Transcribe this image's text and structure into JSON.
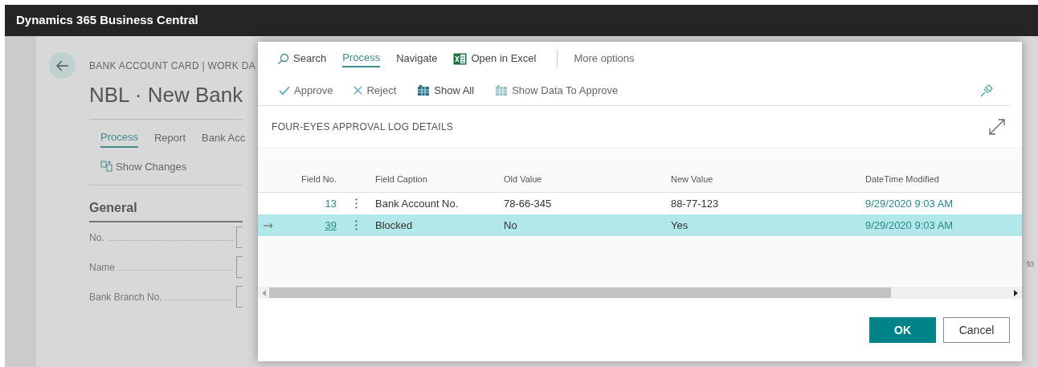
{
  "app_bar": {
    "title": "Dynamics 365 Business Central"
  },
  "background_page": {
    "breadcrumb": "BANK ACCOUNT CARD | WORK DA",
    "title": "NBL · New Bank",
    "tabs": [
      {
        "label": "Process",
        "selected": true
      },
      {
        "label": "Report",
        "selected": false
      },
      {
        "label": "Bank Acc",
        "selected": false
      }
    ],
    "actions": [
      "Show Changes"
    ],
    "section": "General",
    "fields": [
      "No.",
      "Name",
      "Bank Branch No."
    ],
    "side_text": "to"
  },
  "dialog": {
    "nav": [
      {
        "kind": "search",
        "label": "Search",
        "selected": false
      },
      {
        "kind": "tab",
        "label": "Process",
        "selected": true
      },
      {
        "kind": "tab",
        "label": "Navigate",
        "selected": false
      },
      {
        "kind": "excel",
        "label": "Open in Excel",
        "selected": false
      },
      {
        "kind": "more",
        "label": "More options",
        "selected": false
      }
    ],
    "actions": [
      {
        "kind": "approve",
        "label": "Approve"
      },
      {
        "kind": "reject",
        "label": "Reject"
      },
      {
        "kind": "show_all",
        "label": "Show All"
      },
      {
        "kind": "show_data",
        "label": "Show Data To Approve"
      }
    ],
    "title": "FOUR-EYES APPROVAL LOG DETAILS",
    "columns": [
      "Field No.",
      "Field Caption",
      "Old Value",
      "New Value",
      "DateTime Modified"
    ],
    "rows": [
      {
        "field_no": "13",
        "caption": "Bank Account No.",
        "old": "78-66-345",
        "new": "88-77-123",
        "modified": "9/29/2020 9:03 AM",
        "selected": false
      },
      {
        "field_no": "39",
        "caption": "Blocked",
        "old": "No",
        "new": "Yes",
        "modified": "9/29/2020 9:03 AM",
        "selected": true
      }
    ],
    "buttons": [
      {
        "label": "OK",
        "kind": "primary"
      },
      {
        "label": "Cancel",
        "kind": "secondary"
      }
    ]
  }
}
